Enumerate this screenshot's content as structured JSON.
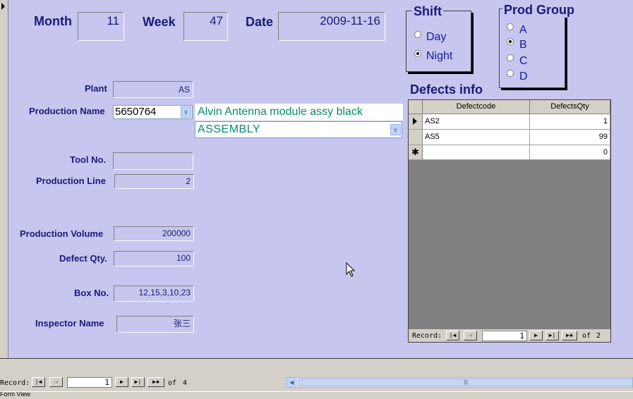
{
  "header": {
    "month_label": "Month",
    "month_value": "11",
    "week_label": "Week",
    "week_value": "47",
    "date_label": "Date",
    "date_value": "2009-11-16"
  },
  "shift": {
    "title": "Shift",
    "options": [
      {
        "label": "Day",
        "selected": false
      },
      {
        "label": "Night",
        "selected": true
      }
    ]
  },
  "prod_group": {
    "title": "Prod Group",
    "options": [
      {
        "label": "A",
        "selected": false
      },
      {
        "label": "B",
        "selected": true
      },
      {
        "label": "C",
        "selected": false
      },
      {
        "label": "D",
        "selected": false
      }
    ]
  },
  "fields": {
    "plant_label": "Plant",
    "plant_value": "AS",
    "production_name_label": "Production Name",
    "production_name_value": "5650764",
    "production_desc": "Alvin Antenna module assy black",
    "process_value": "ASSEMBLY",
    "tool_no_label": "Tool No.",
    "tool_no_value": "",
    "production_line_label": "Production Line",
    "production_line_value": "2",
    "production_volume_label": "Production Volume",
    "production_volume_value": "200000",
    "defect_qty_label": "Defect Qty.",
    "defect_qty_value": "100",
    "box_no_label": "Box No.",
    "box_no_value": "12,15,3,10,23",
    "inspector_name_label": "Inspector Name",
    "inspector_name_value": "张三"
  },
  "defects": {
    "title": "Defects info",
    "columns": [
      "Defectcode",
      "DefectsQty"
    ],
    "rows": [
      [
        "AS2",
        "1"
      ],
      [
        "AS5",
        "99"
      ]
    ],
    "new_row_qty": "0",
    "nav": {
      "label": "Record:",
      "current": "1",
      "of": "of",
      "total": "2"
    }
  },
  "main_nav": {
    "label": "Record:",
    "current": "1",
    "of": "of",
    "total": "4"
  },
  "status_bar": {
    "text": "Form View"
  }
}
